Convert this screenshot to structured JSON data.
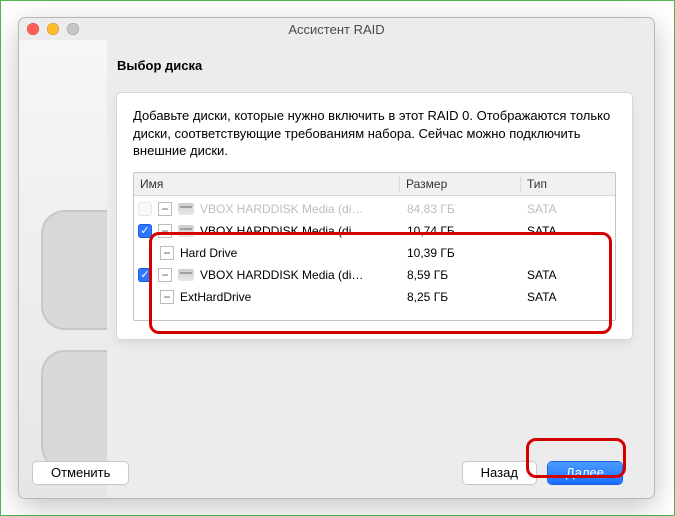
{
  "window_title": "Ассистент RAID",
  "heading": "Выбор диска",
  "description": "Добавьте диски, которые нужно включить в этот RAID 0. Отображаются только диски, соответствующие требованиям набора. Сейчас можно подключить внешние диски.",
  "columns": {
    "name": "Имя",
    "size": "Размер",
    "type": "Тип"
  },
  "rows": [
    {
      "checked": false,
      "icon": "hdd-icon",
      "name": "VBOX HARDDISK Media (di…",
      "size": "84,83 ГБ",
      "type": "SATA",
      "disabled": true
    },
    {
      "checked": true,
      "icon": "hdd-icon",
      "name": "VBOX HARDDISK Media (di…",
      "size": "10,74 ГБ",
      "type": "SATA"
    },
    {
      "indent": true,
      "name": "Hard Drive",
      "size": "10,39 ГБ",
      "type": ""
    },
    {
      "checked": true,
      "icon": "hdd-icon",
      "name": "VBOX HARDDISK Media (di…",
      "size": "8,59 ГБ",
      "type": "SATA"
    },
    {
      "indent": true,
      "name": "ExtHardDrive",
      "size": "8,25 ГБ",
      "type": "SATA"
    }
  ],
  "buttons": {
    "cancel": "Отменить",
    "back": "Назад",
    "next": "Далее"
  },
  "colors": {
    "highlight": "#d40000",
    "primary": "#2f77ff"
  }
}
